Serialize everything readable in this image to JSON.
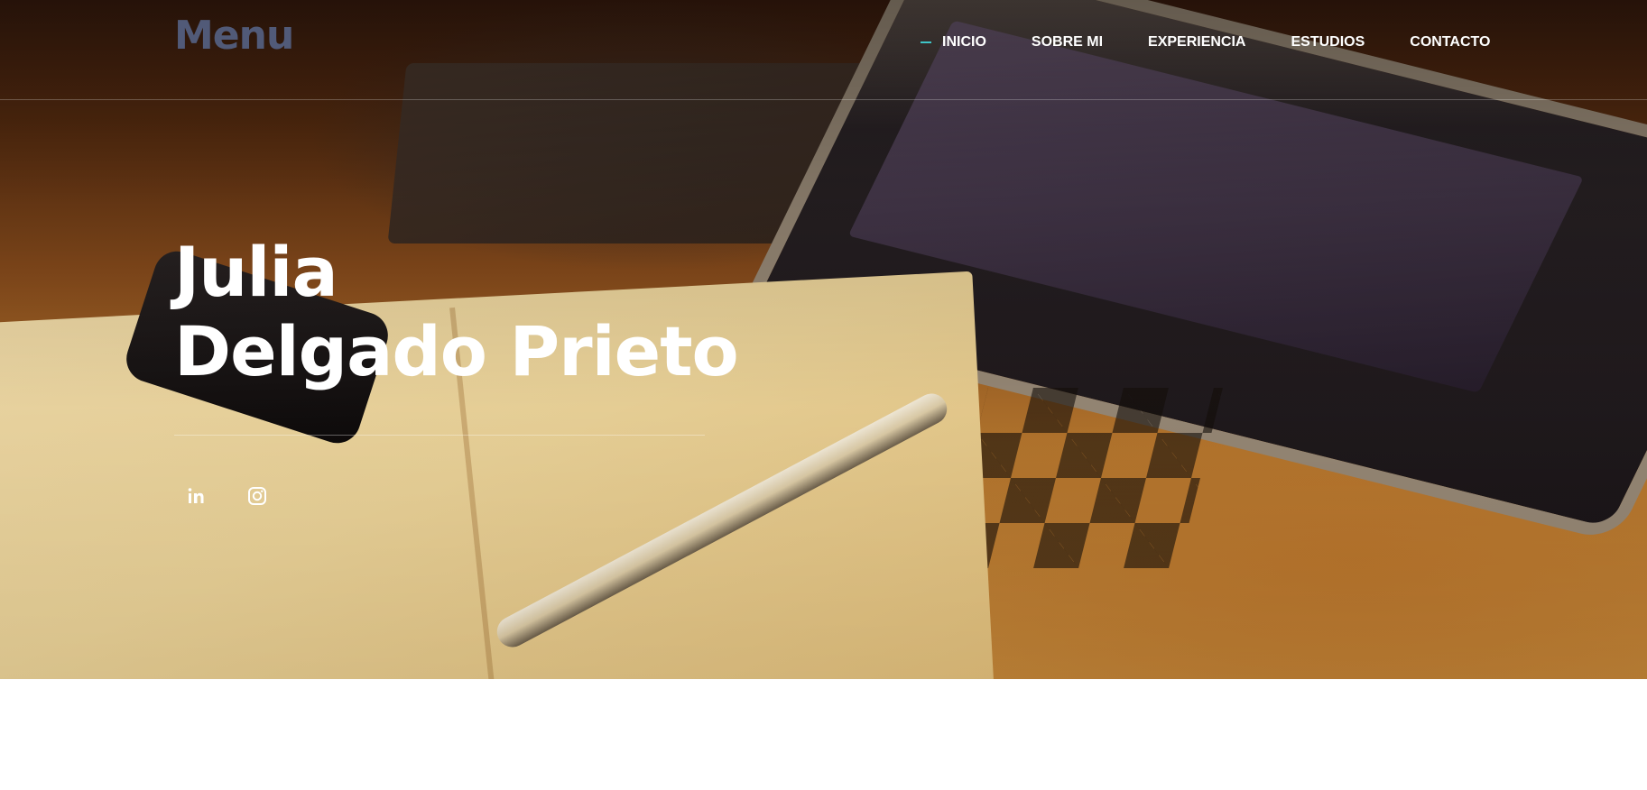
{
  "header": {
    "brand": "Menu",
    "nav": [
      {
        "label": "INICIO",
        "active": true
      },
      {
        "label": "SOBRE MI",
        "active": false
      },
      {
        "label": "EXPERIENCIA",
        "active": false
      },
      {
        "label": "ESTUDIOS",
        "active": false
      },
      {
        "label": "CONTACTO",
        "active": false
      }
    ],
    "accent_color": "#3fc5c7",
    "brand_color": "#515a78"
  },
  "hero": {
    "name_line1": "Julia",
    "name_line2": "Delgado Prieto",
    "social": [
      {
        "icon": "linkedin-icon"
      },
      {
        "icon": "instagram-icon"
      }
    ]
  }
}
